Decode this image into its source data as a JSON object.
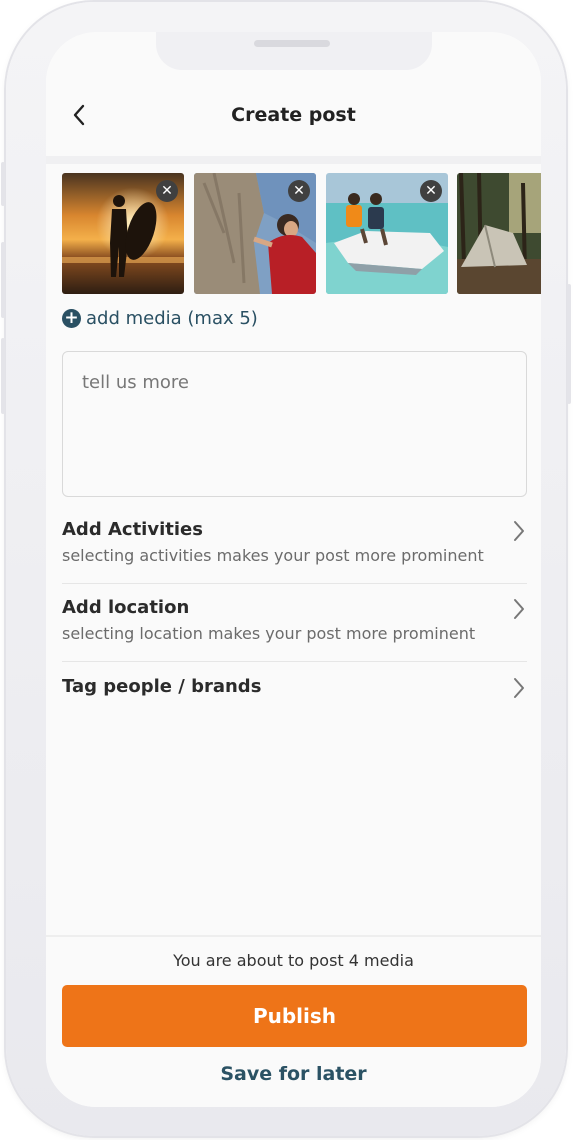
{
  "header": {
    "title": "Create post",
    "back_icon": "chevron-left-icon"
  },
  "media": {
    "items": [
      {
        "name": "surfer-silhouette-photo",
        "close_icon": "close-icon"
      },
      {
        "name": "rock-climber-photo",
        "close_icon": "close-icon"
      },
      {
        "name": "jet-ski-photo",
        "close_icon": "close-icon"
      },
      {
        "name": "camping-tent-photo"
      }
    ],
    "add_label": "add media (max 5)",
    "add_icon": "plus-circle-icon"
  },
  "description": {
    "placeholder": "tell us more"
  },
  "options": [
    {
      "title": "Add Activities",
      "subtitle": "selecting activities makes your post more prominent",
      "icon": "chevron-right-icon"
    },
    {
      "title": "Add location",
      "subtitle": "selecting location makes your post more prominent",
      "icon": "chevron-right-icon"
    },
    {
      "title": "Tag people / brands",
      "icon": "chevron-right-icon"
    }
  ],
  "footer": {
    "count_text": "You are about to post 4 media",
    "publish_label": "Publish",
    "save_label": "Save for later"
  },
  "colors": {
    "accent": "#ee7418",
    "link": "#2a5063"
  }
}
